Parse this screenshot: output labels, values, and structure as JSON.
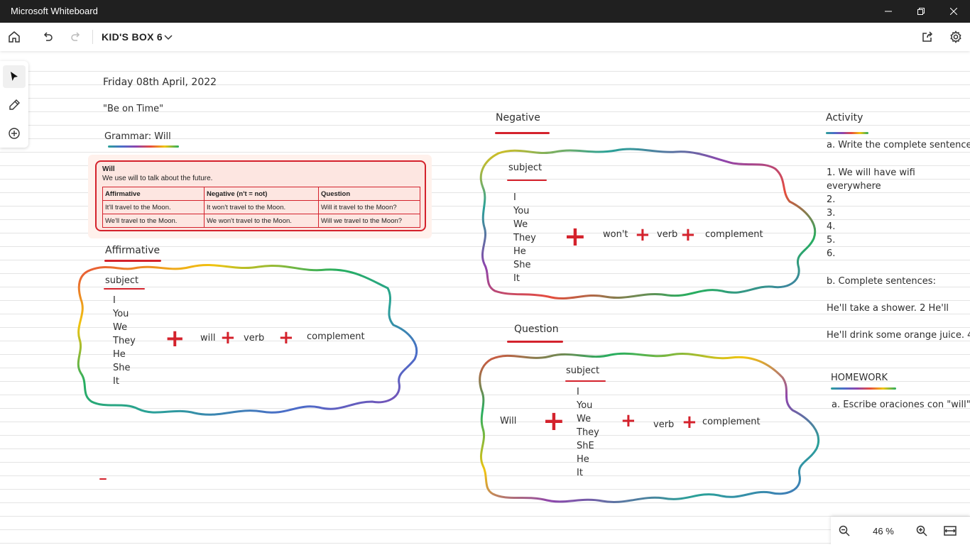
{
  "window": {
    "title": "Microsoft Whiteboard"
  },
  "toolbar": {
    "board_name": "KID'S BOX 6"
  },
  "board": {
    "date": "Friday 08th April, 2022",
    "motto": "\"Be on Time\"",
    "grammar_heading": "Grammar: Will",
    "card": {
      "title": "Will",
      "subtitle": "We use will to talk about the future.",
      "headers": [
        "Affirmative",
        "Negative (n't = not)",
        "Question"
      ],
      "rows": [
        [
          "It'll travel to the Moon.",
          "It won't travel to the Moon.",
          "Will it travel to the Moon?"
        ],
        [
          "We'll travel to the Moon.",
          "We won't travel to the Moon.",
          "Will we travel to the Moon?"
        ]
      ]
    },
    "affirmative": {
      "heading": "Affirmative",
      "subject": "subject",
      "pronouns": [
        "I",
        "You",
        "We",
        "They",
        "He",
        "She",
        "It"
      ],
      "aux": "will",
      "verb": "verb",
      "complement": "complement"
    },
    "negative": {
      "heading": "Negative",
      "subject": "subject",
      "pronouns": [
        "I",
        "You",
        "We",
        "They",
        "He",
        "She",
        "It"
      ],
      "aux": "won't",
      "verb": "verb",
      "complement": "complement"
    },
    "question": {
      "heading": "Question",
      "subject": "subject",
      "pronouns": [
        "I",
        "You",
        "We",
        "They",
        "ShE",
        "He",
        "It"
      ],
      "aux": "Will",
      "verb": "verb",
      "complement": "complement"
    },
    "activity": {
      "heading": "Activity",
      "instruction_a": "a. Write the complete sentence",
      "items": [
        "1. We will have wifi everywhere",
        "2.",
        "3.",
        "4.",
        "5.",
        "6."
      ],
      "instruction_b": "b. Complete sentences:",
      "line1": "He'll take a shower.  2     He'll",
      "line2": "He'll drink some orange juice. 4"
    },
    "homework": {
      "heading": "HOMEWORK",
      "instruction": "a. Escribe oraciones con \"will\" o"
    }
  },
  "zoom": {
    "level": "46 %"
  },
  "colors": {
    "ink_red": "#d4222c",
    "link_blue": "#3f86c4",
    "titlebar": "#202020"
  }
}
